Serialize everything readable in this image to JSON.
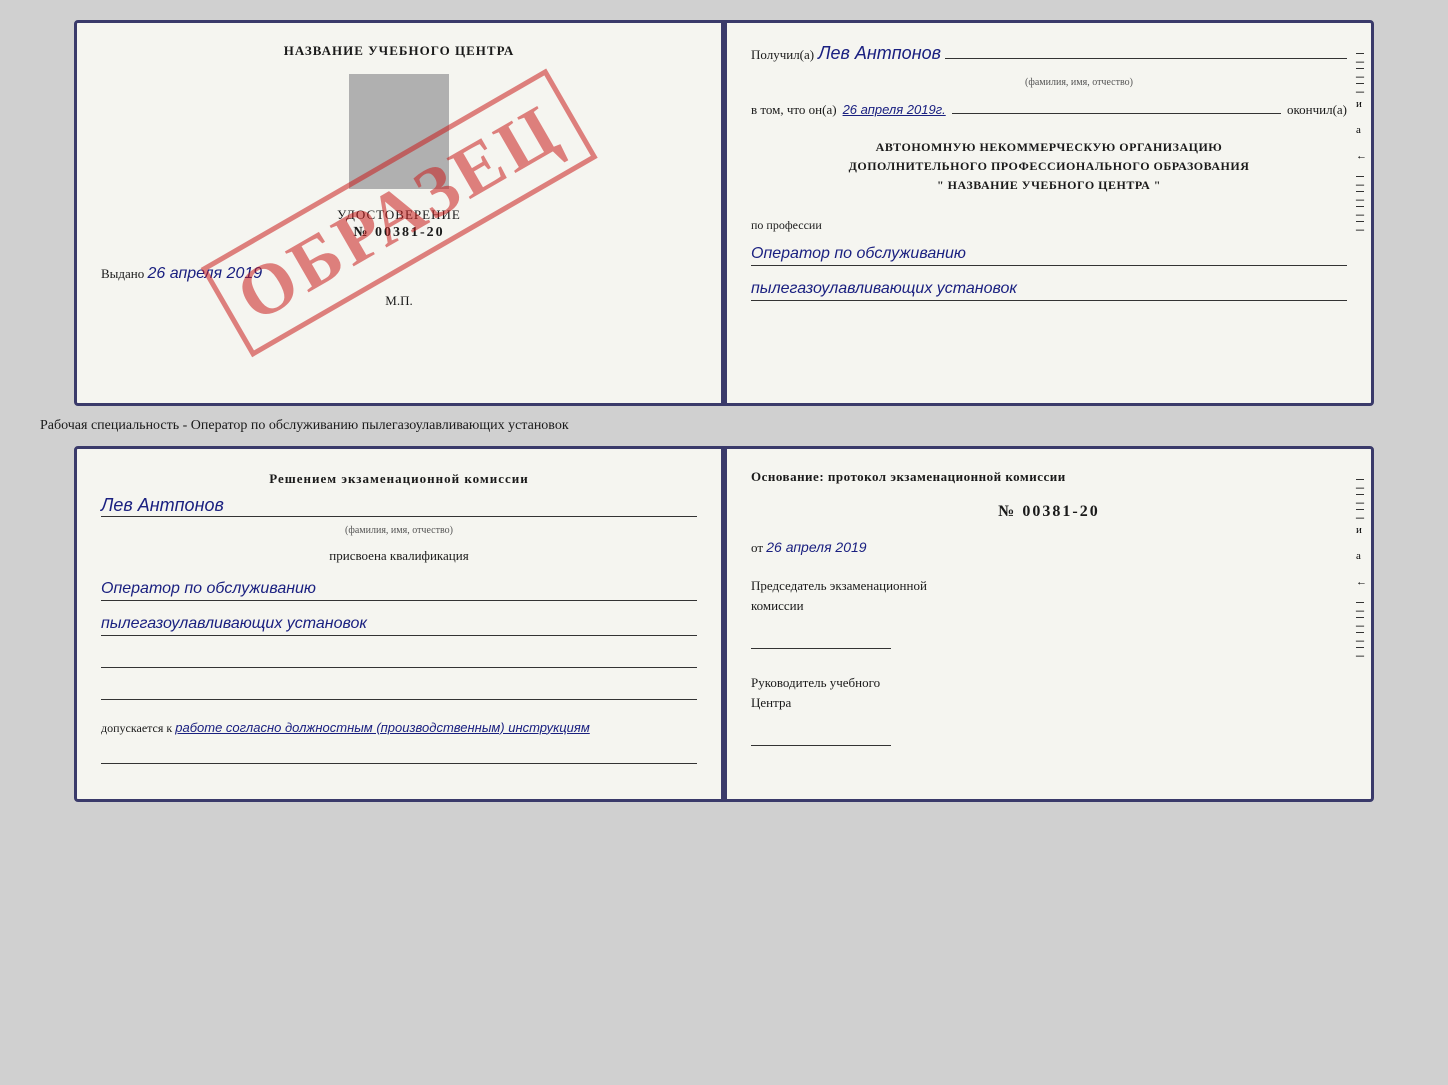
{
  "cert_top": {
    "left": {
      "school_name": "НАЗВАНИЕ УЧЕБНОГО ЦЕНТРА",
      "title": "УДОСТОВЕРЕНИЕ",
      "number": "№ 00381-20",
      "issued_label": "Выдано",
      "issued_date": "26 апреля 2019",
      "mp_label": "М.П.",
      "watermark": "ОБРАЗЕЦ"
    },
    "right": {
      "received_label": "Получил(а)",
      "recipient_name": "Лев Антпонов",
      "recipient_subtitle": "(фамилия, имя, отчество)",
      "completed_prefix": "в том, что он(а)",
      "completed_date": "26 апреля 2019г.",
      "completed_suffix": "окончил(а)",
      "org_line1": "АВТОНОМНУЮ НЕКОММЕРЧЕСКУЮ ОРГАНИЗАЦИЮ",
      "org_line2": "ДОПОЛНИТЕЛЬНОГО ПРОФЕССИОНАЛЬНОГО ОБРАЗОВАНИЯ",
      "org_line3": "\" НАЗВАНИЕ УЧЕБНОГО ЦЕНТРА \"",
      "profession_label": "по профессии",
      "profession_line1": "Оператор по обслуживанию",
      "profession_line2": "пылегазоулавливающих установок"
    }
  },
  "between_label": "Рабочая специальность - Оператор по обслуживанию пылегазоулавливающих установок",
  "cert_bottom": {
    "left": {
      "commission_text": "Решением экзаменационной комиссии",
      "name_handwritten": "Лев Антпонов",
      "name_subtitle": "(фамилия, имя, отчество)",
      "assigned_text": "присвоена квалификация",
      "qualification_line1": "Оператор по обслуживанию",
      "qualification_line2": "пылегазоулавливающих установок",
      "admission_prefix": "допускается к",
      "admission_text": "работе согласно должностным (производственным) инструкциям"
    },
    "right": {
      "basis_text": "Основание: протокол экзаменационной комиссии",
      "protocol_number": "№ 00381-20",
      "from_prefix": "от",
      "from_date": "26 апреля 2019",
      "chairman_line1": "Председатель экзаменационной",
      "chairman_line2": "комиссии",
      "director_line1": "Руководитель учебного",
      "director_line2": "Центра"
    }
  },
  "ticks": [
    "–",
    "–",
    "–",
    "и",
    "а",
    "←",
    "–",
    "–",
    "–",
    "–"
  ]
}
